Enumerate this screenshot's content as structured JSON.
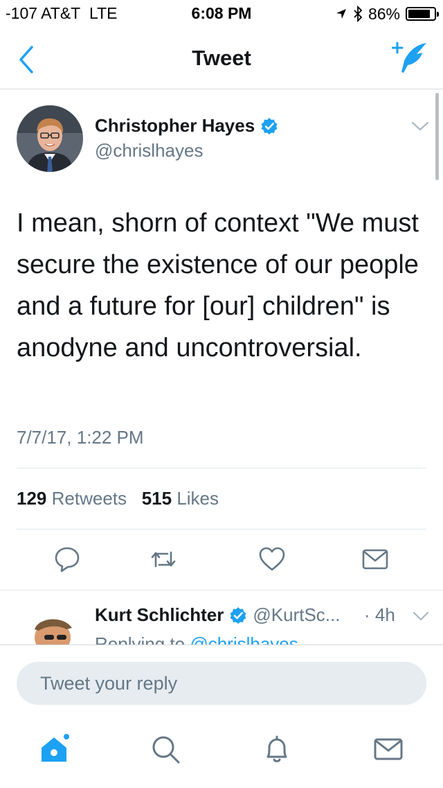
{
  "status_bar": {
    "signal": "-107 AT&T",
    "network": "LTE",
    "time": "6:08 PM",
    "battery": "86%",
    "battery_level": 0.86
  },
  "nav": {
    "title": "Tweet",
    "back_icon": "chevron-left-icon",
    "compose_icon": "compose-tweet-icon"
  },
  "tweet": {
    "author_name": "Christopher Hayes",
    "author_handle": "@chrislhayes",
    "text": "I mean, shorn of context \"We must secure the existence of our people and a future for [our] children\" is anodyne and uncontroversial.",
    "date": "7/7/17, 1:22 PM",
    "retweet_count": "129",
    "retweet_label": "Retweets",
    "like_count": "515",
    "like_label": "Likes"
  },
  "actions": [
    "reply-icon",
    "retweet-icon",
    "like-icon",
    "message-icon"
  ],
  "reply": {
    "author_name": "Kurt Schlichter",
    "author_handle": "@KurtSc...",
    "time": "· 4h",
    "replying_prefix": "Replying to",
    "replying_to": "@chrislhayes"
  },
  "composer": {
    "placeholder": "Tweet your reply"
  },
  "tab_bar": [
    "home-icon",
    "search-icon",
    "notifications-icon",
    "messages-icon"
  ],
  "colors": {
    "accent": "#1da1f2",
    "secondary_text": "#657786",
    "primary_text": "#14171a"
  }
}
